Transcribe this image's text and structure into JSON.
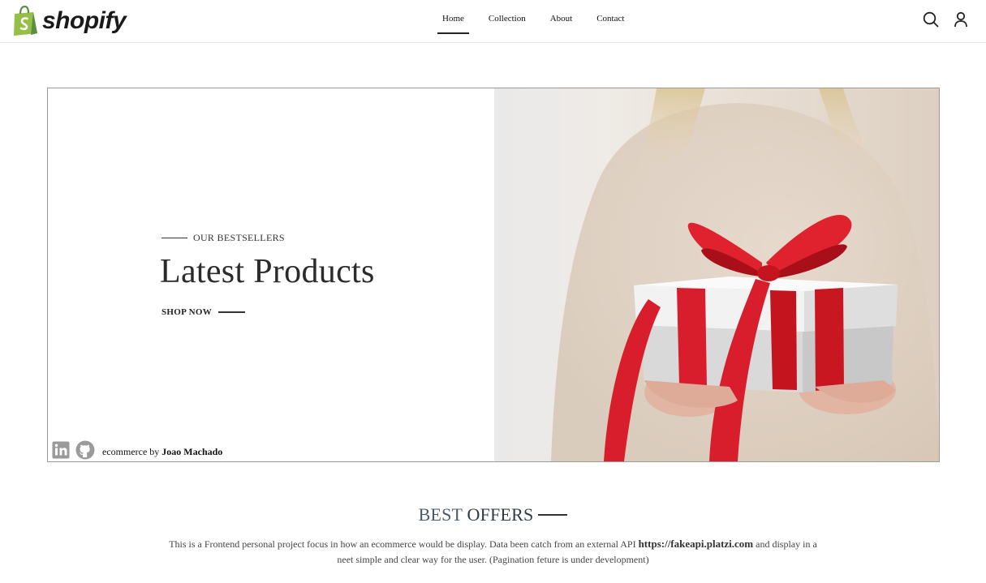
{
  "brand": {
    "name": "shopify"
  },
  "nav": {
    "items": [
      {
        "label": "Home",
        "active": true
      },
      {
        "label": "Collection",
        "active": false
      },
      {
        "label": "About",
        "active": false
      },
      {
        "label": "Contact",
        "active": false
      }
    ]
  },
  "header_icons": [
    "search-icon",
    "user-icon"
  ],
  "hero": {
    "eyebrow": "OUR BESTSELLERS",
    "title": "Latest Products",
    "cta": "SHOP NOW",
    "credit_prefix": "ecommerce by",
    "credit_author": "Joao Machado",
    "social_icons": [
      "linkedin-icon",
      "github-icon"
    ]
  },
  "offers": {
    "title_light": "BEST",
    "title_strong": "OFFERS",
    "description_start": "This is a Frontend personal project focus in how an ecommerce would be display. Data been catch from an external API",
    "api_url": "https://fakeapi.platzi.com",
    "description_end": "and display in a neet simple and clear way for the user. (Pagination feture is under development)"
  },
  "colors": {
    "brand_green": "#95bf47",
    "ribbon_red": "#d81e2c",
    "text_dark": "#222222",
    "offers_title": "#4a5a6a"
  }
}
